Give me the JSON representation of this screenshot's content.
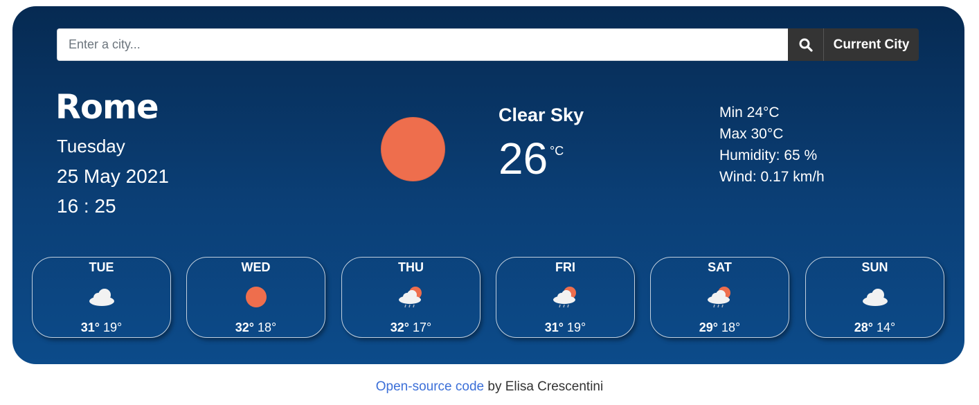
{
  "search": {
    "placeholder": "Enter a city...",
    "current_city_label": "Current City"
  },
  "current": {
    "city": "Rome",
    "day": "Tuesday",
    "date": "25 May 2021",
    "time": "16 : 25",
    "description": "Clear Sky",
    "temperature": "26",
    "unit": "°C",
    "icon": "sun-icon",
    "min": "Min 24°C",
    "max": "Max 30°C",
    "humidity": "Humidity: 65 %",
    "wind": "Wind: 0.17 km/h"
  },
  "forecast": [
    {
      "day": "TUE",
      "max": "31°",
      "min": "19°",
      "icon": "cloud-icon"
    },
    {
      "day": "WED",
      "max": "32°",
      "min": "18°",
      "icon": "sun-icon"
    },
    {
      "day": "THU",
      "max": "32°",
      "min": "17°",
      "icon": "sun-cloud-rain-icon"
    },
    {
      "day": "FRI",
      "max": "31°",
      "min": "19°",
      "icon": "sun-cloud-rain-icon"
    },
    {
      "day": "SAT",
      "max": "29°",
      "min": "18°",
      "icon": "sun-cloud-rain-icon"
    },
    {
      "day": "SUN",
      "max": "28°",
      "min": "14°",
      "icon": "cloud-icon"
    }
  ],
  "footer": {
    "link_text": "Open-source code",
    "suffix": " by Elisa Crescentini"
  },
  "colors": {
    "sun": "#ee6e4d",
    "card_top": "#062a52",
    "card_bottom": "#0c4b8a",
    "button": "#343434",
    "link": "#3b6fd8"
  }
}
